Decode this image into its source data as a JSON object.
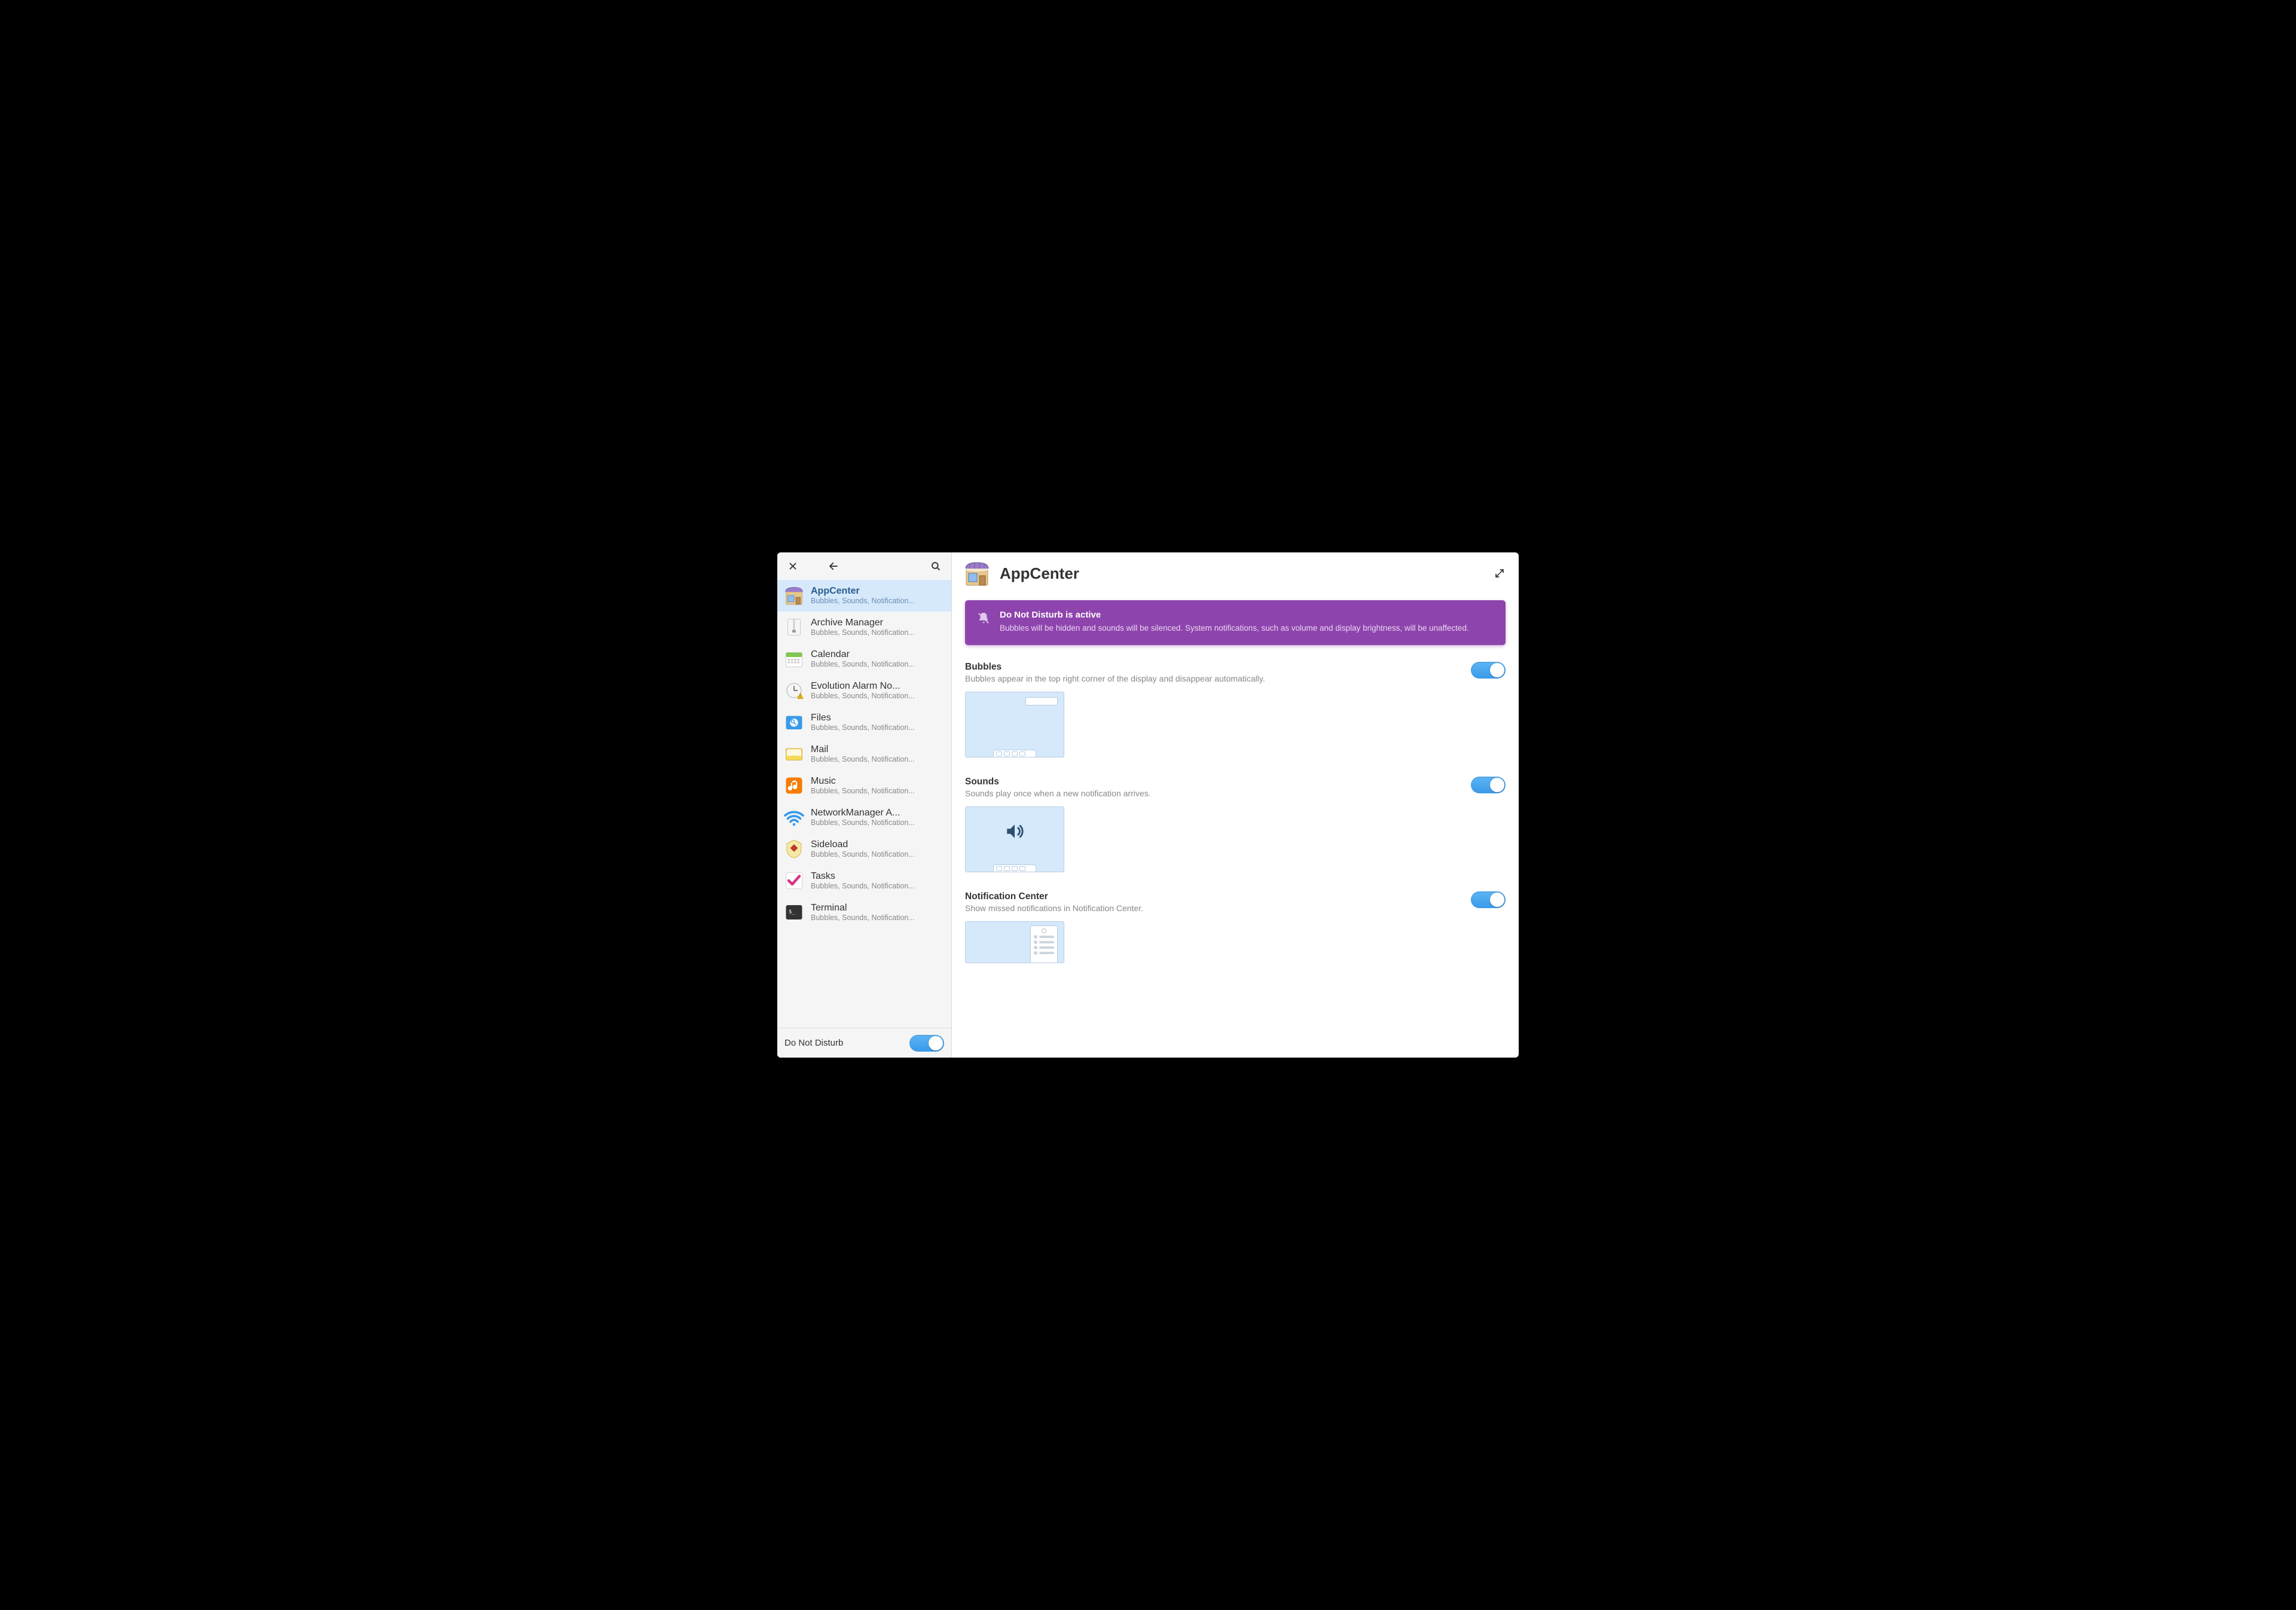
{
  "header": {
    "title": "AppCenter"
  },
  "banner": {
    "title": "Do Not Disturb is active",
    "body": "Bubbles will be hidden and sounds will be silenced. System notifications, such as volume and display brightness, will be unaffected."
  },
  "settings": {
    "bubbles": {
      "title": "Bubbles",
      "desc": "Bubbles appear in the top right corner of the display and disappear automatically.",
      "enabled": true
    },
    "sounds": {
      "title": "Sounds",
      "desc": "Sounds play once when a new notification arrives.",
      "enabled": true
    },
    "notification_center": {
      "title": "Notification Center",
      "desc": "Show missed notifications in Notification Center.",
      "enabled": true
    }
  },
  "dnd": {
    "label": "Do Not Disturb",
    "enabled": true
  },
  "sidebar": {
    "items": [
      {
        "name": "AppCenter",
        "sub": "Bubbles, Sounds, Notification...",
        "icon": "appcenter",
        "selected": true
      },
      {
        "name": "Archive Manager",
        "sub": "Bubbles, Sounds, Notification...",
        "icon": "archive",
        "selected": false
      },
      {
        "name": "Calendar",
        "sub": "Bubbles, Sounds, Notification...",
        "icon": "calendar",
        "selected": false
      },
      {
        "name": "Evolution Alarm No...",
        "sub": "Bubbles, Sounds, Notification...",
        "icon": "alarm",
        "selected": false
      },
      {
        "name": "Files",
        "sub": "Bubbles, Sounds, Notification...",
        "icon": "files",
        "selected": false
      },
      {
        "name": "Mail",
        "sub": "Bubbles, Sounds, Notification...",
        "icon": "mail",
        "selected": false
      },
      {
        "name": "Music",
        "sub": "Bubbles, Sounds, Notification...",
        "icon": "music",
        "selected": false
      },
      {
        "name": "NetworkManager A...",
        "sub": "Bubbles, Sounds, Notification...",
        "icon": "network",
        "selected": false
      },
      {
        "name": "Sideload",
        "sub": "Bubbles, Sounds, Notification...",
        "icon": "sideload",
        "selected": false
      },
      {
        "name": "Tasks",
        "sub": "Bubbles, Sounds, Notification...",
        "icon": "tasks",
        "selected": false
      },
      {
        "name": "Terminal",
        "sub": "Bubbles, Sounds, Notification...",
        "icon": "terminal",
        "selected": false
      }
    ]
  }
}
